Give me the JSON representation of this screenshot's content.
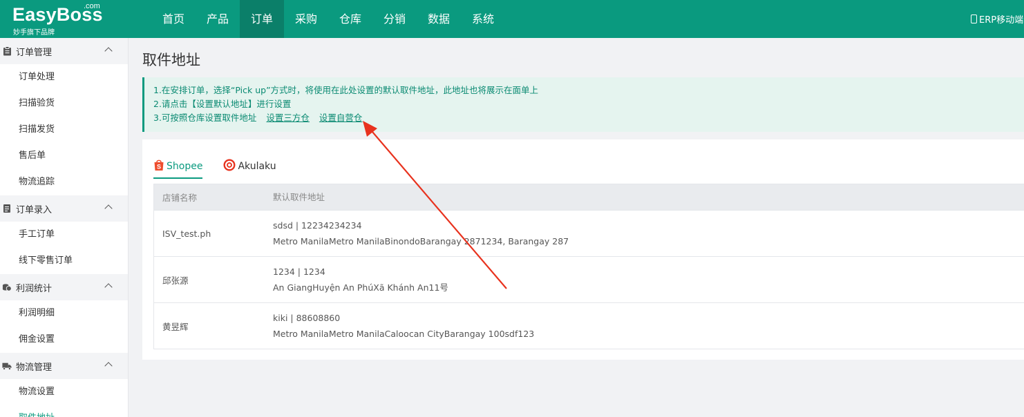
{
  "header": {
    "logo_brand": "EasyBoss",
    "logo_com": ".com",
    "logo_slogan": "妙手旗下品牌",
    "nav": [
      "首页",
      "产品",
      "订单",
      "采购",
      "仓库",
      "分销",
      "数据",
      "系统"
    ],
    "active_nav": 2,
    "erp_mobile": "ERP移动端"
  },
  "sidebar": {
    "groups": [
      {
        "title": "订单管理",
        "icon": "clipboard-icon",
        "items": [
          "订单处理",
          "扫描验货",
          "扫描发货",
          "售后单",
          "物流追踪"
        ]
      },
      {
        "title": "订单录入",
        "icon": "form-icon",
        "items": [
          "手工订单",
          "线下零售订单"
        ]
      },
      {
        "title": "利润统计",
        "icon": "coins-icon",
        "items": [
          "利润明细",
          "佣金设置"
        ]
      },
      {
        "title": "物流管理",
        "icon": "truck-icon",
        "items": [
          "物流设置",
          "取件地址"
        ]
      }
    ]
  },
  "main": {
    "title": "取件地址",
    "notice": {
      "line1": "1.在安排订单，选择“Pick up”方式时，将使用在此处设置的默认取件地址，此地址也将展示在面单上",
      "line2": "2.请点击【设置默认地址】进行设置",
      "line3": "3.可按照仓库设置取件地址",
      "link1": "设置三方仓",
      "link2": "设置自营仓"
    },
    "tabs": [
      {
        "label": "Shopee",
        "icon": "shopee-bag-icon"
      },
      {
        "label": "Akulaku",
        "icon": "akulaku-circle-icon"
      }
    ],
    "table": {
      "headers": [
        "店铺名称",
        "默认取件地址"
      ],
      "rows": [
        {
          "store": "ISV_test.ph",
          "contact": "sdsd | 12234234234",
          "address": "Metro ManilaMetro ManilaBinondoBarangay 2871234, Barangay 287"
        },
        {
          "store": "邱张源",
          "contact": "1234 | 1234",
          "address": "An GiangHuyện An PhúXã Khánh An11号"
        },
        {
          "store": "黄昱辉",
          "contact": "kiki | 88608860",
          "address": "Metro ManilaMetro ManilaCaloocan CityBarangay 100sdf123"
        }
      ]
    }
  },
  "colors": {
    "brand": "#0a9a7f",
    "nav_active": "#0b7f69",
    "notice_bg": "#e5f4ef",
    "arrow": "#e8321e"
  }
}
